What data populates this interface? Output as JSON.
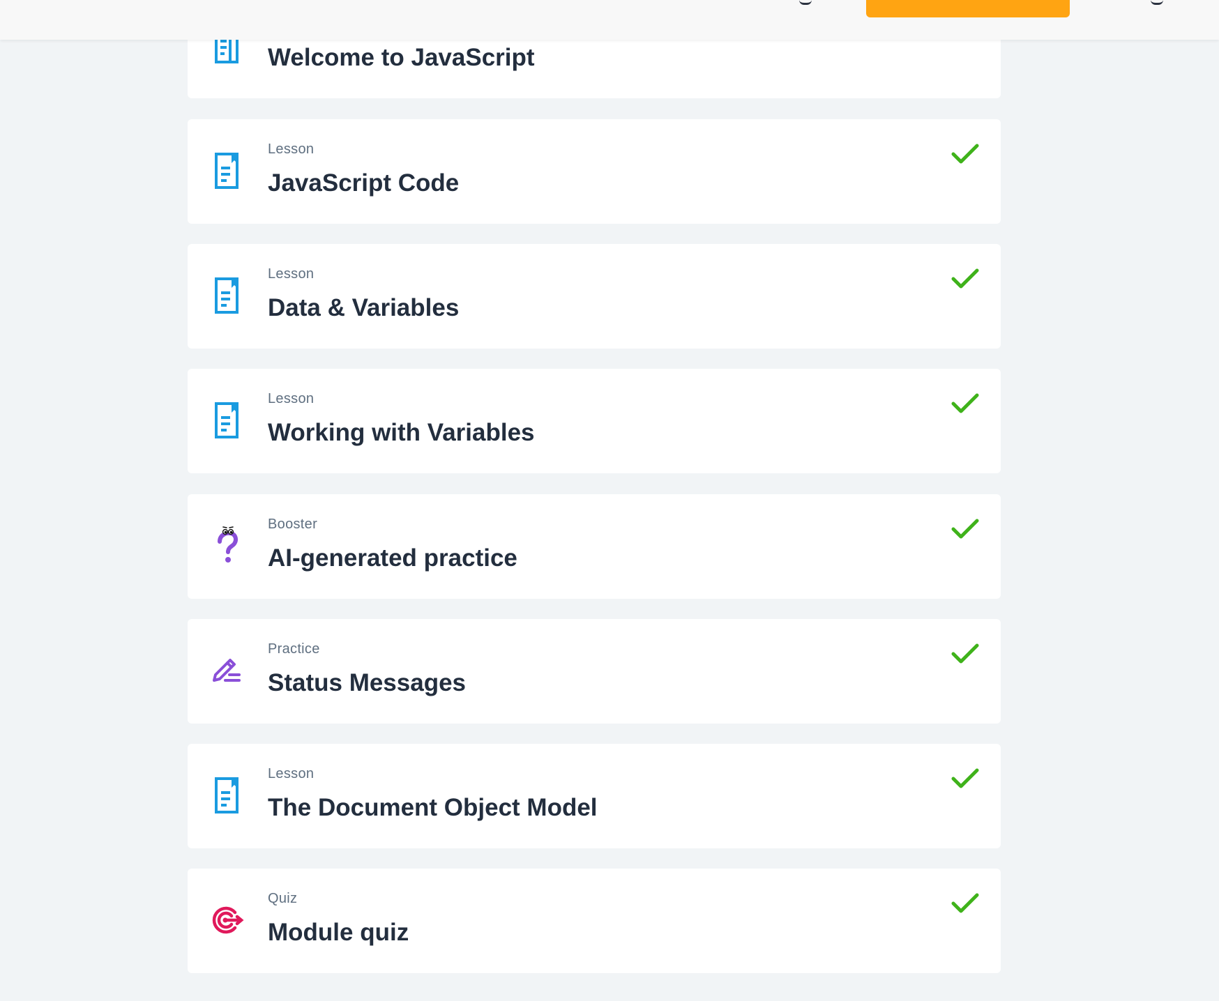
{
  "items": [
    {
      "type": "",
      "title": "Welcome to JavaScript",
      "icon": "lesson-document-icon",
      "completed": false
    },
    {
      "type": "Lesson",
      "title": "JavaScript Code",
      "icon": "lesson-document-icon",
      "completed": true
    },
    {
      "type": "Lesson",
      "title": "Data & Variables",
      "icon": "lesson-document-icon",
      "completed": true
    },
    {
      "type": "Lesson",
      "title": "Working with Variables",
      "icon": "lesson-document-icon",
      "completed": true
    },
    {
      "type": "Booster",
      "title": "AI-generated practice",
      "icon": "question-mark-character-icon",
      "completed": true
    },
    {
      "type": "Practice",
      "title": "Status Messages",
      "icon": "pencil-lines-icon",
      "completed": true
    },
    {
      "type": "Lesson",
      "title": "The Document Object Model",
      "icon": "lesson-document-icon",
      "completed": true
    },
    {
      "type": "Quiz",
      "title": "Module quiz",
      "icon": "target-arrow-icon",
      "completed": true
    }
  ],
  "colors": {
    "lesson_icon": "#1a9be0",
    "booster_icon": "#8a4fd8",
    "practice_icon": "#8a4fd8",
    "quiz_icon": "#e0195b",
    "check": "#3fb21a",
    "cta": "#ffa412"
  }
}
